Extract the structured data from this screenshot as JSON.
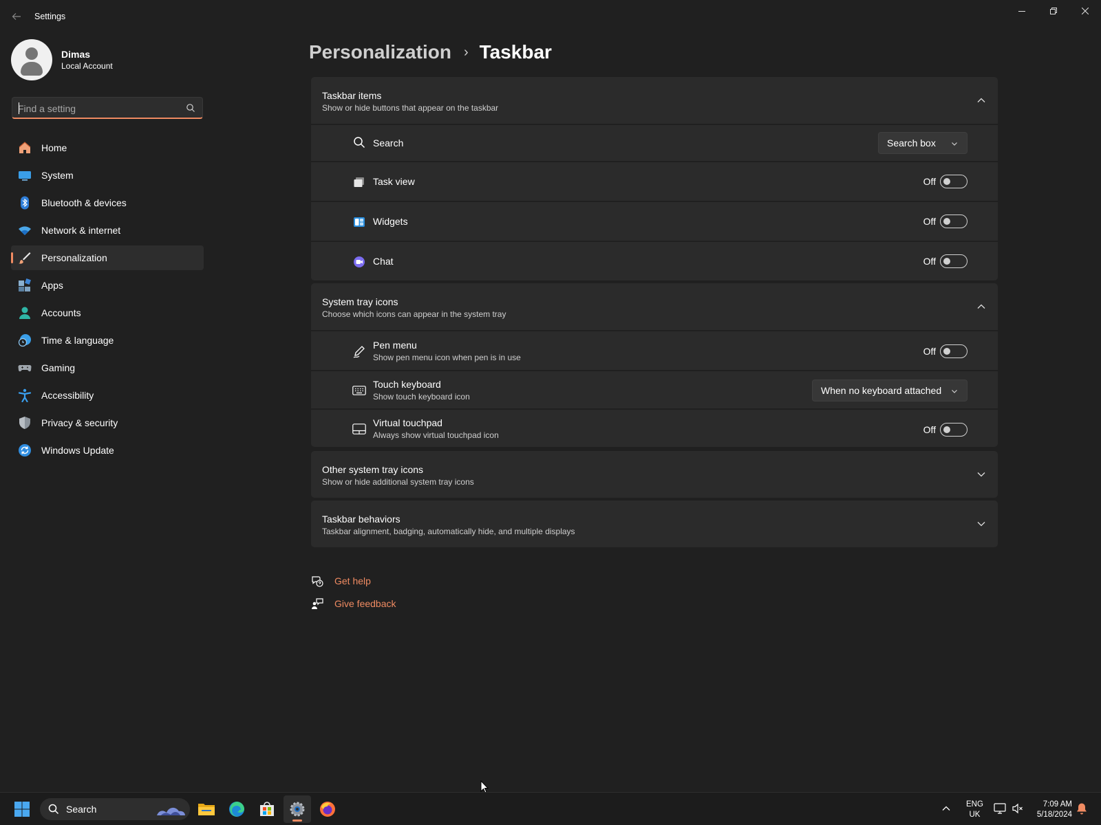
{
  "app": {
    "title": "Settings"
  },
  "profile": {
    "name": "Dimas",
    "account_type": "Local Account"
  },
  "search": {
    "placeholder": "Find a setting",
    "value": ""
  },
  "nav": {
    "items": [
      {
        "label": "Home",
        "icon": "home-icon"
      },
      {
        "label": "System",
        "icon": "system-icon"
      },
      {
        "label": "Bluetooth & devices",
        "icon": "bluetooth-icon"
      },
      {
        "label": "Network & internet",
        "icon": "network-icon"
      },
      {
        "label": "Personalization",
        "icon": "personalization-icon",
        "active": true
      },
      {
        "label": "Apps",
        "icon": "apps-icon"
      },
      {
        "label": "Accounts",
        "icon": "accounts-icon"
      },
      {
        "label": "Time & language",
        "icon": "time-language-icon"
      },
      {
        "label": "Gaming",
        "icon": "gaming-icon"
      },
      {
        "label": "Accessibility",
        "icon": "accessibility-icon"
      },
      {
        "label": "Privacy & security",
        "icon": "privacy-icon"
      },
      {
        "label": "Windows Update",
        "icon": "windows-update-icon"
      }
    ]
  },
  "breadcrumb": {
    "parent": "Personalization",
    "separator": "›",
    "current": "Taskbar"
  },
  "sections": {
    "taskbar_items": {
      "title": "Taskbar items",
      "description": "Show or hide buttons that appear on the taskbar",
      "expanded": true,
      "rows": {
        "search": {
          "label": "Search",
          "control": "dropdown",
          "value": "Search box",
          "icon": "search-icon"
        },
        "task_view": {
          "label": "Task view",
          "state": "Off",
          "icon": "task-view-icon"
        },
        "widgets": {
          "label": "Widgets",
          "state": "Off",
          "icon": "widgets-icon"
        },
        "chat": {
          "label": "Chat",
          "state": "Off",
          "icon": "chat-icon"
        }
      }
    },
    "system_tray_icons": {
      "title": "System tray icons",
      "description": "Choose which icons can appear in the system tray",
      "expanded": true,
      "rows": {
        "pen_menu": {
          "label": "Pen menu",
          "description": "Show pen menu icon when pen is in use",
          "state": "Off",
          "icon": "pen-icon"
        },
        "touch_keyboard": {
          "label": "Touch keyboard",
          "description": "Show touch keyboard icon",
          "control": "dropdown",
          "value": "When no keyboard attached",
          "icon": "keyboard-icon"
        },
        "virtual_touchpad": {
          "label": "Virtual touchpad",
          "description": "Always show virtual touchpad icon",
          "state": "Off",
          "icon": "touchpad-icon"
        }
      }
    },
    "other_tray_icons": {
      "title": "Other system tray icons",
      "description": "Show or hide additional system tray icons",
      "expanded": false
    },
    "taskbar_behaviors": {
      "title": "Taskbar behaviors",
      "description": "Taskbar alignment, badging, automatically hide, and multiple displays",
      "expanded": false
    }
  },
  "links": {
    "get_help": "Get help",
    "give_feedback": "Give feedback"
  },
  "taskbar": {
    "search_label": "Search",
    "pinned": [
      "start-icon",
      "file-explorer-icon",
      "edge-icon",
      "store-icon",
      "settings-icon",
      "firefox-icon"
    ],
    "language": {
      "line1": "ENG",
      "line2": "UK"
    },
    "time": "7:09 AM",
    "date": "5/18/2024"
  },
  "colors": {
    "accent": "#f08b62",
    "background": "#202020",
    "card": "#2b2b2b"
  }
}
